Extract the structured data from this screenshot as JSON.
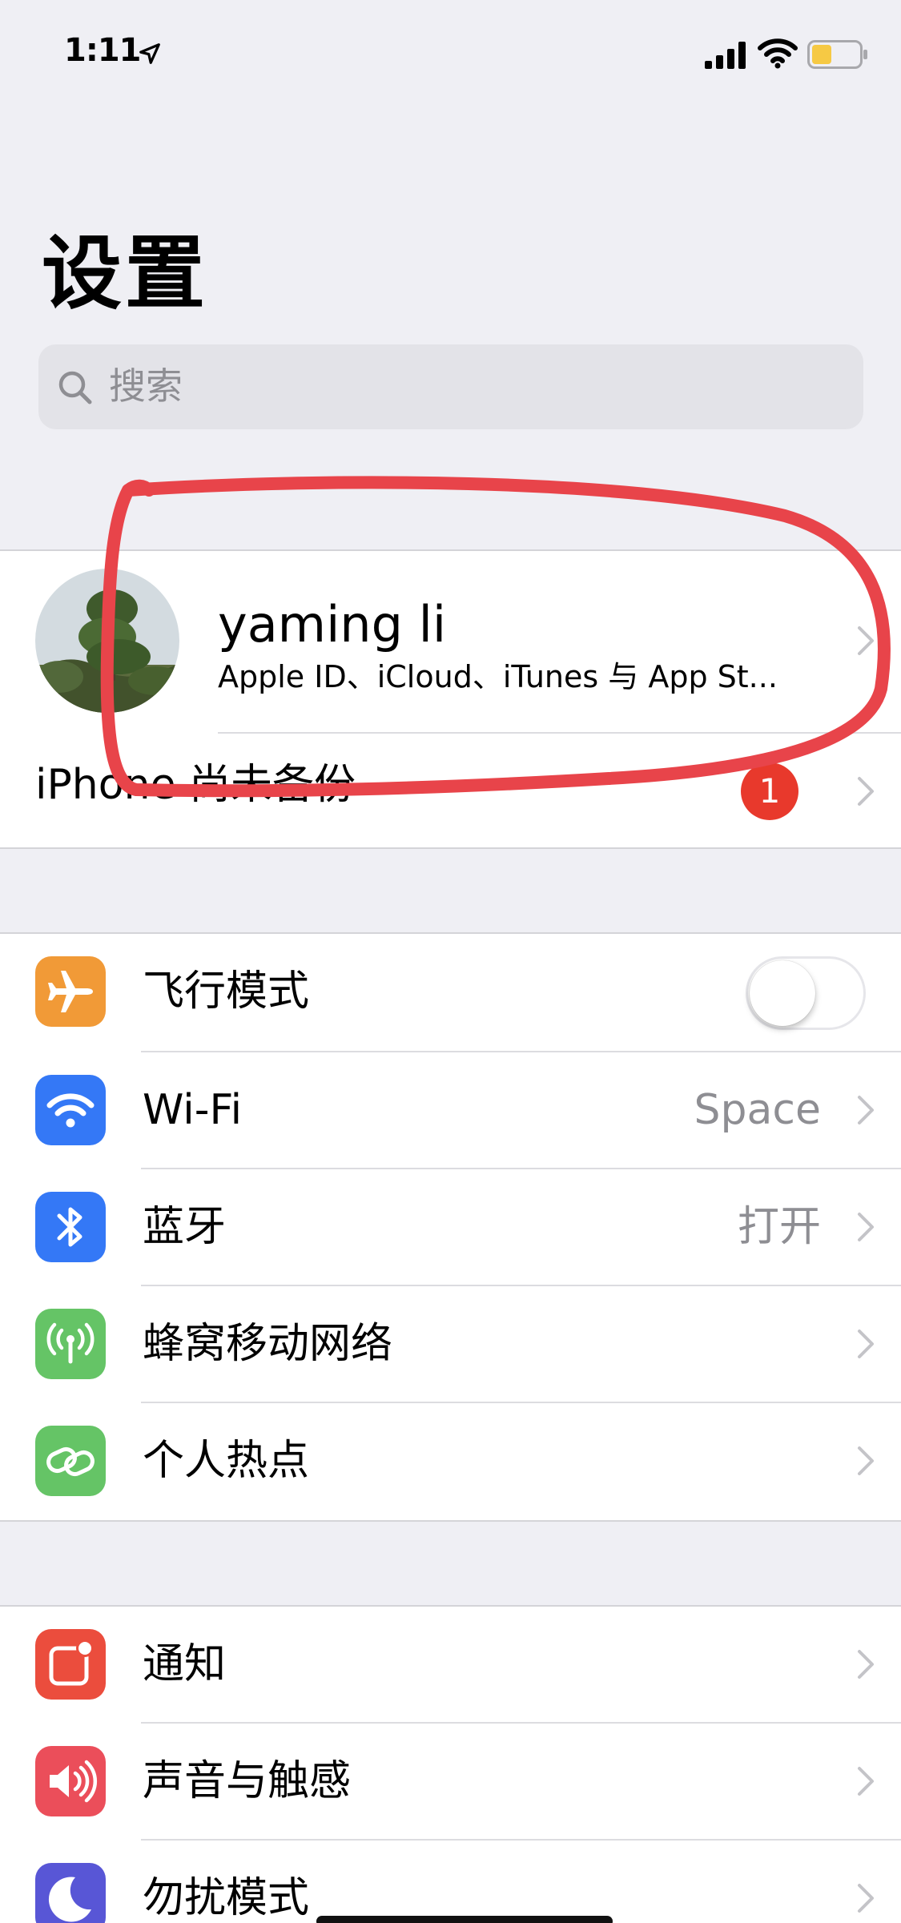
{
  "status_bar": {
    "time": "1:11",
    "icons": [
      "location-arrow-icon",
      "cellular-signal-icon",
      "wifi-icon",
      "battery-icon"
    ],
    "battery_color": "#f6c944"
  },
  "header": {
    "title": "设置",
    "search": {
      "placeholder": "搜索"
    }
  },
  "profile": {
    "name": "yaming li",
    "subtitle": "Apple ID、iCloud、iTunes 与 App St..."
  },
  "backup": {
    "label": "iPhone 尚未备份",
    "badge": "1"
  },
  "connectivity": {
    "items": [
      {
        "label": "飞行模式",
        "icon": "airplane-icon",
        "color": "#f19a37",
        "toggle_on": false
      },
      {
        "label": "Wi-Fi",
        "icon": "wifi-icon",
        "color": "#3478f6",
        "value": "Space"
      },
      {
        "label": "蓝牙",
        "icon": "bluetooth-icon",
        "color": "#3478f6",
        "value": "打开"
      },
      {
        "label": "蜂窝移动网络",
        "icon": "cellular-antenna-icon",
        "color": "#65c466"
      },
      {
        "label": "个人热点",
        "icon": "hotspot-link-icon",
        "color": "#65c466"
      }
    ]
  },
  "notifications_group": {
    "items": [
      {
        "label": "通知",
        "icon": "notifications-icon",
        "color": "#eb4d3d"
      },
      {
        "label": "声音与触感",
        "icon": "speaker-icon",
        "color": "#eb4e5a"
      },
      {
        "label": "勿扰模式",
        "icon": "moon-icon",
        "color": "#5856d6"
      }
    ]
  },
  "colors": {
    "background": "#efeff4",
    "annotation_stroke": "#e8444a",
    "secondary_text": "#8e8e93"
  }
}
